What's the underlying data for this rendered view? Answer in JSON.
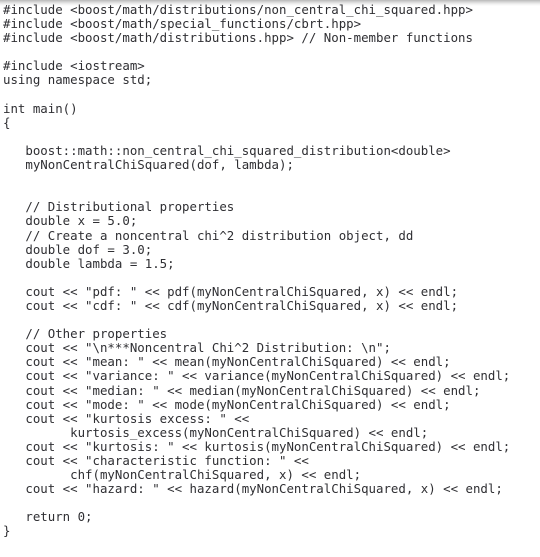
{
  "document": {
    "kind": "source-code-listing",
    "language": "C++",
    "background_color": "#ffffff",
    "text_color": "#2f2f33",
    "top_band_color": "#b9b9b9"
  },
  "code": {
    "lines": [
      "#include <boost/math/distributions/non_central_chi_squared.hpp>",
      "#include <boost/math/special_functions/cbrt.hpp>",
      "#include <boost/math/distributions.hpp> // Non-member functions",
      "",
      "#include <iostream>",
      "using namespace std;",
      "",
      "int main()",
      "{",
      "",
      "   boost::math::non_central_chi_squared_distribution<double>",
      "   myNonCentralChiSquared(dof, lambda);",
      "",
      "",
      "   // Distributional properties",
      "   double x = 5.0;",
      "   // Create a noncentral chi^2 distribution object, dd",
      "   double dof = 3.0;",
      "   double lambda = 1.5;",
      "",
      "   cout << \"pdf: \" << pdf(myNonCentralChiSquared, x) << endl;",
      "   cout << \"cdf: \" << cdf(myNonCentralChiSquared, x) << endl;",
      "",
      "   // Other properties",
      "   cout << \"\\n***Noncentral Chi^2 Distribution: \\n\";",
      "   cout << \"mean: \" << mean(myNonCentralChiSquared) << endl;",
      "   cout << \"variance: \" << variance(myNonCentralChiSquared) << endl;",
      "   cout << \"median: \" << median(myNonCentralChiSquared) << endl;",
      "   cout << \"mode: \" << mode(myNonCentralChiSquared) << endl;",
      "   cout << \"kurtosis excess: \" <<",
      "         kurtosis_excess(myNonCentralChiSquared) << endl;",
      "   cout << \"kurtosis: \" << kurtosis(myNonCentralChiSquared) << endl;",
      "   cout << \"characteristic function: \" <<",
      "         chf(myNonCentralChiSquared, x) << endl;",
      "   cout << \"hazard: \" << hazard(myNonCentralChiSquared, x) << endl;",
      "",
      "   return 0;",
      "}"
    ]
  }
}
